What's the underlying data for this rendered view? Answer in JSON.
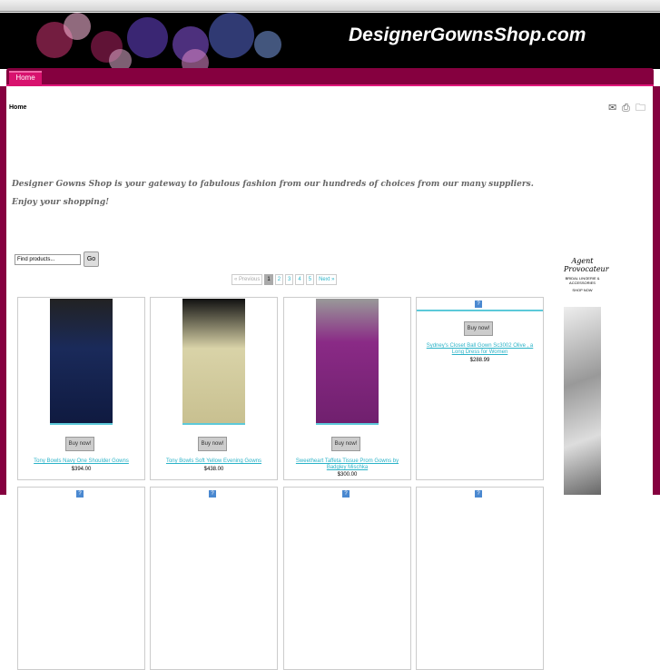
{
  "site": {
    "title": "DesignerGownsShop.com"
  },
  "nav": {
    "tabs": [
      {
        "label": "Home"
      }
    ]
  },
  "breadcrumb": "Home",
  "intro": {
    "line1": "Designer Gowns Shop is your gateway to fabulous fashion from our hundreds of choices from our many suppliers.",
    "line2": "Enjoy your shopping!"
  },
  "search": {
    "placeholder": "Find products...",
    "go": "Go"
  },
  "pager": {
    "prev": "« Previous",
    "pages": [
      "1",
      "2",
      "3",
      "4",
      "5"
    ],
    "next": "Next »",
    "current": "1"
  },
  "products": [
    {
      "name": "Tony Bowls Navy One Shoulder Gowns",
      "price": "$394.00",
      "buy": "Buy now!",
      "color": "#1a2a5a"
    },
    {
      "name": "Tony Bowls Soft Yellow Evening Gowns",
      "price": "$438.00",
      "buy": "Buy now!",
      "color": "#d9d3a8"
    },
    {
      "name": "Sweetheart Taffeta Tissue Prom Gowns by Badgley Mischka",
      "price": "$300.00",
      "buy": "Buy now!",
      "color": "#8a2a86"
    },
    {
      "name": "Sydney's Closet Ball Gown Sc3002 Olive , a Long Dress for Women",
      "price": "$288.99",
      "buy": "Buy now!"
    }
  ],
  "ad": {
    "brand": "Agent Provocateur",
    "sub": "BRIDAL LINGERIE & ACCESSORIES",
    "cta": "SHOP NOW"
  }
}
